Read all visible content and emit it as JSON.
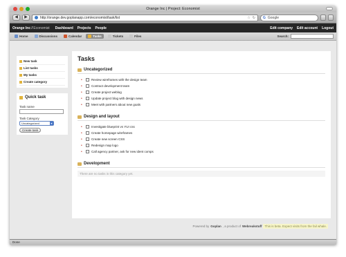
{
  "window": {
    "title": "Orange Inc | Project: Economist"
  },
  "browser": {
    "back_glyph": "◀",
    "forward_glyph": "▶",
    "url": "http://orange.dev.goplanapp.com/economist/task/list",
    "search_placeholder": "Google",
    "search_logo": "G",
    "status": "Done"
  },
  "header": {
    "brand": "Orange Inc /",
    "project": "Economist",
    "nav": [
      "Dashboard",
      "Projects",
      "People"
    ],
    "account": [
      "Edit company",
      "Edit account",
      "Logout"
    ]
  },
  "tabs": [
    {
      "label": "Home",
      "color": "#6a8fcc"
    },
    {
      "label": "Discussions",
      "color": "#8aa8d6"
    },
    {
      "label": "Calendar",
      "color": "#d0562e"
    },
    {
      "label": "Tasks",
      "color": "#e8b43b"
    },
    {
      "label": "Tickets",
      "color": "#c8c8c8"
    },
    {
      "label": "Files",
      "color": "#c8c8c8"
    }
  ],
  "search": {
    "label": "Search:"
  },
  "sidebar": {
    "links": [
      "New task",
      "List tasks",
      "My tasks",
      "Create category"
    ],
    "quick_task": {
      "title": "Quick task",
      "name_label": "Task name",
      "category_label": "Task Category",
      "category_value": "Uncategorized",
      "button": "Create task"
    }
  },
  "main": {
    "title": "Tasks",
    "categories": [
      {
        "name": "Uncategorized",
        "tasks": [
          "Review wireframes with the design team",
          "Contract development team",
          "Create project weblog",
          "Update project blog with design news",
          "Meet with partners about new goals"
        ]
      },
      {
        "name": "Design and layout",
        "tasks": [
          "Investigate blueprint vs YUI css",
          "Create homepage wireframes",
          "Create new screen CSS",
          "Redesign map logo",
          "Call agency partner, ask for new ident comps"
        ]
      },
      {
        "name": "Development",
        "tasks": [],
        "empty_text": "There are no tasks in this category yet."
      }
    ]
  },
  "footer": {
    "prefix": "Powered by",
    "product": "Goplan",
    "middle": ", a product of",
    "company": "Webreakstuff",
    "beta": "This is beta. Expect visits from the fail whale."
  }
}
